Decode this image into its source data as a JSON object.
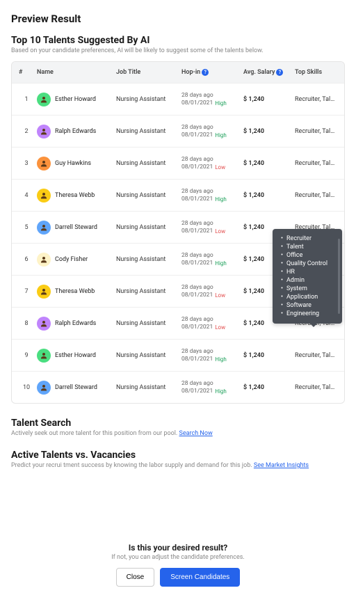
{
  "page_title": "Preview Result",
  "top_section": {
    "title": "Top 10 Talents Suggested By AI",
    "subtitle": "Based on your candidate preferences, AI will be likely to suggest some of the talents below."
  },
  "table": {
    "headers": {
      "num": "#",
      "name": "Name",
      "job": "Job Title",
      "hopin": "Hop-in",
      "salary": "Avg. Salary",
      "skills": "Top Skills"
    },
    "rows": [
      {
        "num": "1",
        "avatar_bg": "#4ade80",
        "name": "Esther Howard",
        "job": "Nursing Assistant",
        "days": "28 days ago",
        "date": "08/01/2021",
        "tag": "High",
        "tag_class": "tag-high",
        "salary": "$ 1,240",
        "skills": "Recruiter, Talent, Offi..."
      },
      {
        "num": "2",
        "avatar_bg": "#c084fc",
        "name": "Ralph Edwards",
        "job": "Nursing Assistant",
        "days": "28 days ago",
        "date": "08/01/2021",
        "tag": "High",
        "tag_class": "tag-high",
        "salary": "$ 1,240",
        "skills": "Recruiter, Talent, Offi..."
      },
      {
        "num": "3",
        "avatar_bg": "#fb923c",
        "name": "Guy Hawkins",
        "job": "Nursing Assistant",
        "days": "28 days ago",
        "date": "08/01/2021",
        "tag": "Low",
        "tag_class": "tag-low",
        "salary": "$ 1,240",
        "skills": "Recruiter, Talent, Offi..."
      },
      {
        "num": "4",
        "avatar_bg": "#facc15",
        "name": "Theresa Webb",
        "job": "Nursing Assistant",
        "days": "28 days ago",
        "date": "08/01/2021",
        "tag": "High",
        "tag_class": "tag-high",
        "salary": "$ 1,240",
        "skills": "Recruiter, Talent, Offi..."
      },
      {
        "num": "5",
        "avatar_bg": "#60a5fa",
        "name": "Darrell Steward",
        "job": "Nursing Assistant",
        "days": "28 days ago",
        "date": "08/01/2021",
        "tag": "Low",
        "tag_class": "tag-low",
        "salary": "$ 1,240",
        "skills": "Recruiter, Talent, Offi..."
      },
      {
        "num": "6",
        "avatar_bg": "#fef3c7",
        "name": "Cody Fisher",
        "job": "Nursing Assistant",
        "days": "28 days ago",
        "date": "08/01/2021",
        "tag": "High",
        "tag_class": "tag-high",
        "salary": "$ 1,240",
        "skills": "Recruiter, Talent, Offi..."
      },
      {
        "num": "7",
        "avatar_bg": "#facc15",
        "name": "Theresa Webb",
        "job": "Nursing Assistant",
        "days": "28 days ago",
        "date": "08/01/2021",
        "tag": "Low",
        "tag_class": "tag-low",
        "salary": "$ 1,240",
        "skills": "Recruiter, Talent, Offi..."
      },
      {
        "num": "8",
        "avatar_bg": "#c084fc",
        "name": "Ralph Edwards",
        "job": "Nursing Assistant",
        "days": "28 days ago",
        "date": "08/01/2021",
        "tag": "Low",
        "tag_class": "tag-low",
        "salary": "$ 1,240",
        "skills": "Recruiter, Talent, Offi..."
      },
      {
        "num": "9",
        "avatar_bg": "#4ade80",
        "name": "Esther Howard",
        "job": "Nursing Assistant",
        "days": "28 days ago",
        "date": "08/01/2021",
        "tag": "High",
        "tag_class": "tag-high",
        "salary": "$ 1,240",
        "skills": "Recruiter, Talent, Offi..."
      },
      {
        "num": "10",
        "avatar_bg": "#60a5fa",
        "name": "Darrell Steward",
        "job": "Nursing Assistant",
        "days": "28 days ago",
        "date": "08/01/2021",
        "tag": "High",
        "tag_class": "tag-high",
        "salary": "$ 1,240",
        "skills": "Recruiter, Talent, Offi..."
      }
    ]
  },
  "tooltip_items": [
    "Recruiter",
    "Talent",
    "Office",
    "Quality Control",
    "HR",
    "Admin",
    "System",
    "Application",
    "Software",
    "Engineering"
  ],
  "talent_search": {
    "title": "Talent Search",
    "text": "Actively seek out more talent for this position from our pool. ",
    "link": "Search Now"
  },
  "active_talents": {
    "title": "Active Talents vs. Vacancies",
    "text": "Predict your recrui tment success by knowing the labor supply and demand for this job. ",
    "link": "See Market Insights"
  },
  "footer": {
    "title": "Is this your desired result?",
    "sub": "If not, you can adjust the candidate preferences.",
    "close_btn": "Close",
    "screen_btn": "Screen Candidates"
  }
}
